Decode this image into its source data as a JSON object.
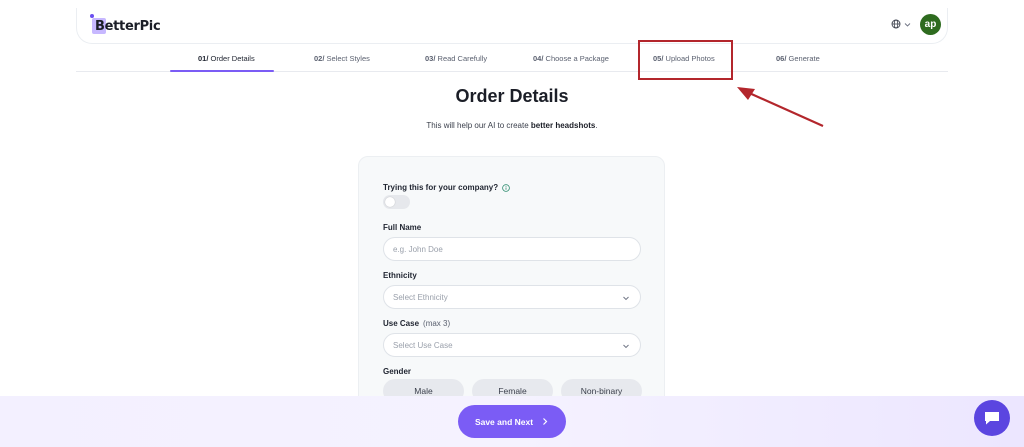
{
  "header": {
    "logo_text": "BetterPic",
    "avatar_initials": "ap",
    "lang_icon": "globe-icon"
  },
  "steps": [
    {
      "num": "01/",
      "label": "Order Details",
      "active": true
    },
    {
      "num": "02/",
      "label": "Select Styles",
      "active": false
    },
    {
      "num": "03/",
      "label": "Read Carefully",
      "active": false
    },
    {
      "num": "04/",
      "label": "Choose a Package",
      "active": false
    },
    {
      "num": "05/",
      "label": "Upload Photos",
      "active": false
    },
    {
      "num": "06/",
      "label": "Generate",
      "active": false
    }
  ],
  "page": {
    "title": "Order Details",
    "subtitle_prefix": "This will help our AI to create ",
    "subtitle_bold": "better headshots",
    "subtitle_suffix": "."
  },
  "form": {
    "company_label": "Trying this for your company?",
    "company_toggle_on": false,
    "full_name_label": "Full Name",
    "full_name_placeholder": "e.g. John Doe",
    "full_name_value": "",
    "ethnicity_label": "Ethnicity",
    "ethnicity_placeholder": "Select Ethnicity",
    "use_case_label": "Use Case",
    "use_case_hint": "(max 3)",
    "use_case_placeholder": "Select Use Case",
    "gender_label": "Gender",
    "gender_options": [
      "Male",
      "Female",
      "Non-binary"
    ]
  },
  "actions": {
    "save_label": "Save and Next"
  },
  "colors": {
    "accent": "#7b5cf5",
    "highlight": "#b3262c",
    "avatar_bg": "#2e6b1f",
    "chat_bg": "#5b45e0"
  }
}
